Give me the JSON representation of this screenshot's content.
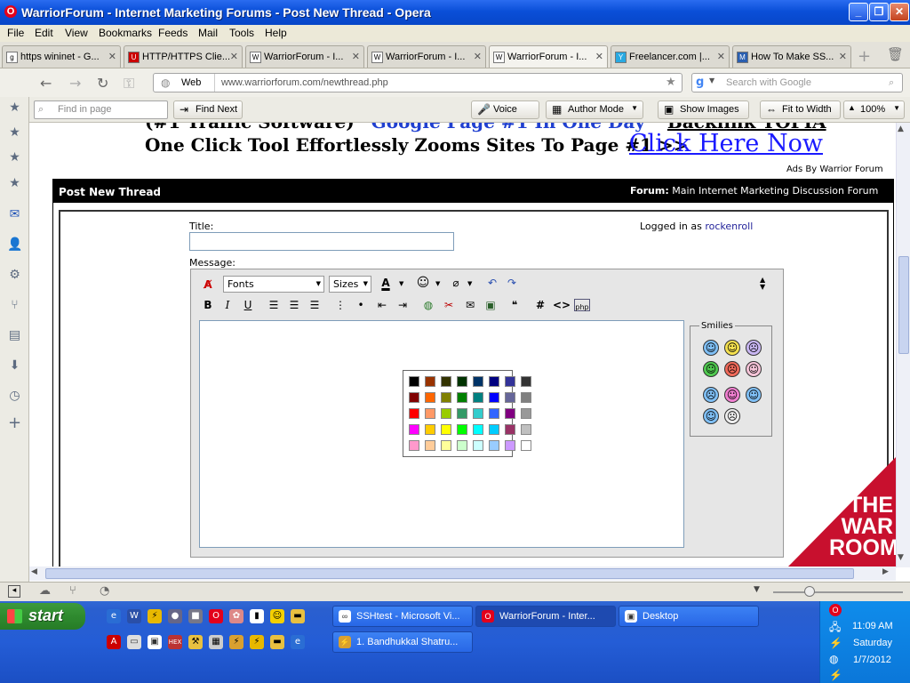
{
  "window": {
    "title": "WarriorForum - Internet Marketing Forums - Post New Thread - Opera"
  },
  "menu": [
    "File",
    "Edit",
    "View",
    "Bookmarks",
    "Feeds",
    "Mail",
    "Tools",
    "Help"
  ],
  "tabs": [
    {
      "label": "https wininet - G..."
    },
    {
      "label": "HTTP/HTTPS Clie..."
    },
    {
      "label": "WarriorForum - I..."
    },
    {
      "label": "WarriorForum - I..."
    },
    {
      "label": "WarriorForum - I..."
    },
    {
      "label": "Freelancer.com |..."
    },
    {
      "label": "How To Make SS..."
    }
  ],
  "address": {
    "mode": "Web",
    "url": "www.warriorforum.com/newthread.php",
    "search_placeholder": "Search with Google"
  },
  "findbar": {
    "placeholder": "Find in page",
    "find_next": "Find Next",
    "voice": "Voice",
    "author_mode": "Author Mode",
    "show_images": "Show Images",
    "fit_to_width": "Fit to Width",
    "zoom": "100%"
  },
  "page": {
    "ad_line1_left": "(#1 Traffic Software)",
    "ad_line1_mid": "Google Page #1 In One Day",
    "ad_line1_right": "Backlink TOPIA",
    "ad_line2_text": "One Click Tool Effortlessly Zooms Sites To Page #1 >>",
    "ad_line2_link": "Click Here Now",
    "ads_by": "Ads By Warrior Forum",
    "header_title": "Post New Thread",
    "forum_label": "Forum:",
    "forum_name": "Main Internet Marketing Discussion Forum",
    "title_label": "Title:",
    "logged_in_prefix": "Logged in as",
    "username": "rockenroll",
    "message_label": "Message:",
    "fonts_label": "Fonts",
    "sizes_label": "Sizes",
    "smilies_label": "Smilies",
    "banner_line1": "THE",
    "banner_line2": "WAR",
    "banner_line3": "ROOM"
  },
  "color_palette": [
    [
      "#000000",
      "#993300",
      "#333300",
      "#003300",
      "#003366",
      "#000080",
      "#333399",
      "#333333"
    ],
    [
      "#800000",
      "#ff6600",
      "#808000",
      "#008000",
      "#008080",
      "#0000ff",
      "#666699",
      "#808080"
    ],
    [
      "#ff0000",
      "#ff9966",
      "#99cc00",
      "#339966",
      "#33cccc",
      "#3366ff",
      "#800080",
      "#999999"
    ],
    [
      "#ff00ff",
      "#ffcc00",
      "#ffff00",
      "#00ff00",
      "#00ffff",
      "#00ccff",
      "#993366",
      "#c0c0c0"
    ],
    [
      "#ff99cc",
      "#ffcc99",
      "#ffff99",
      "#ccffcc",
      "#ccffff",
      "#99ccff",
      "#cc99ff",
      "#ffffff"
    ]
  ],
  "taskbar": {
    "start": "start",
    "tasks": [
      {
        "label": "SSHtest - Microsoft Vi..."
      },
      {
        "label": "WarriorForum - Inter..."
      },
      {
        "label": "Desktop"
      },
      {
        "label": "1. Bandhukkal Shatru..."
      }
    ],
    "clock_time": "11:09 AM",
    "clock_day": "Saturday",
    "clock_date": "1/7/2012"
  },
  "colors": {
    "accent": "#0a4fd8",
    "link": "#1a1aff",
    "taskbar": "#245dd6",
    "banner": "#c8102e"
  }
}
